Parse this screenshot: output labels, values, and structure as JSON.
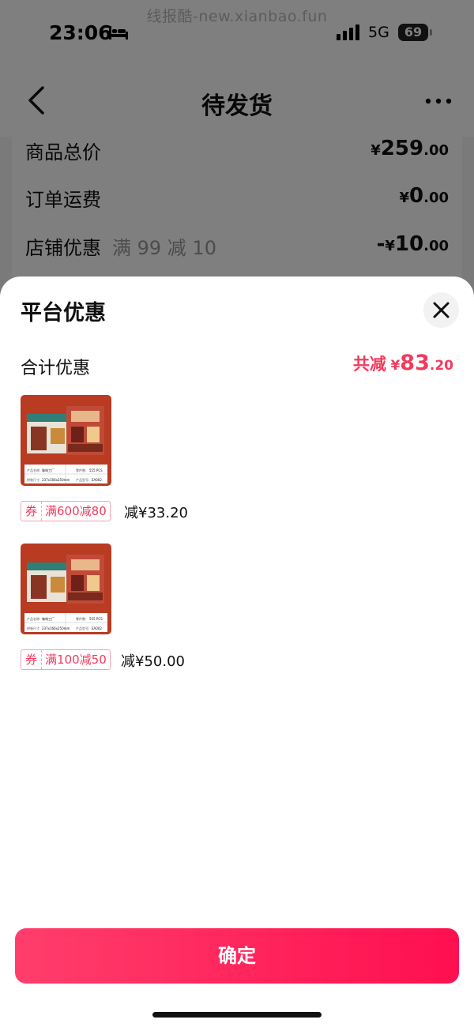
{
  "watermark": "线报酷-new.xianbao.fun",
  "status_bar": {
    "time": "23:06",
    "network": "5G",
    "battery": "69"
  },
  "nav": {
    "title": "待发货"
  },
  "summary": {
    "rows": [
      {
        "label": "商品总价",
        "sub": "",
        "currency": "¥",
        "integer": "259",
        "decimal": ".00",
        "sign": ""
      },
      {
        "label": "订单运费",
        "sub": "",
        "currency": "¥",
        "integer": "0",
        "decimal": ".00",
        "sign": ""
      },
      {
        "label": "店铺优惠",
        "sub": "满 99 减 10",
        "currency": "¥",
        "integer": "10",
        "decimal": ".00",
        "sign": "-"
      }
    ]
  },
  "sheet": {
    "title": "平台优惠",
    "total_label": "合计优惠",
    "total_prefix": "共减",
    "total_currency": "¥",
    "total_integer": "83",
    "total_decimal": ".20",
    "items": [
      {
        "coupon_badge": "券",
        "coupon_text": "满600减80",
        "discount": "减¥33.20"
      },
      {
        "coupon_badge": "券",
        "coupon_text": "满100减50",
        "discount": "减¥50.00"
      }
    ],
    "product_image_text": {
      "name_label": "产品名称:",
      "name_value": "咖啡工厂",
      "parts_label": "零件数:",
      "parts_value": "555 PCS",
      "size_label": "拼装尺寸:",
      "size_value": "237x166x250mm",
      "code_label": "产品型号:",
      "code_value": "EA002"
    },
    "confirm_label": "确定"
  },
  "colors": {
    "accent": "#f23a5d",
    "button_start": "#ff3e6c",
    "button_end": "#ff0f50",
    "product_bg": "#b83b22"
  }
}
